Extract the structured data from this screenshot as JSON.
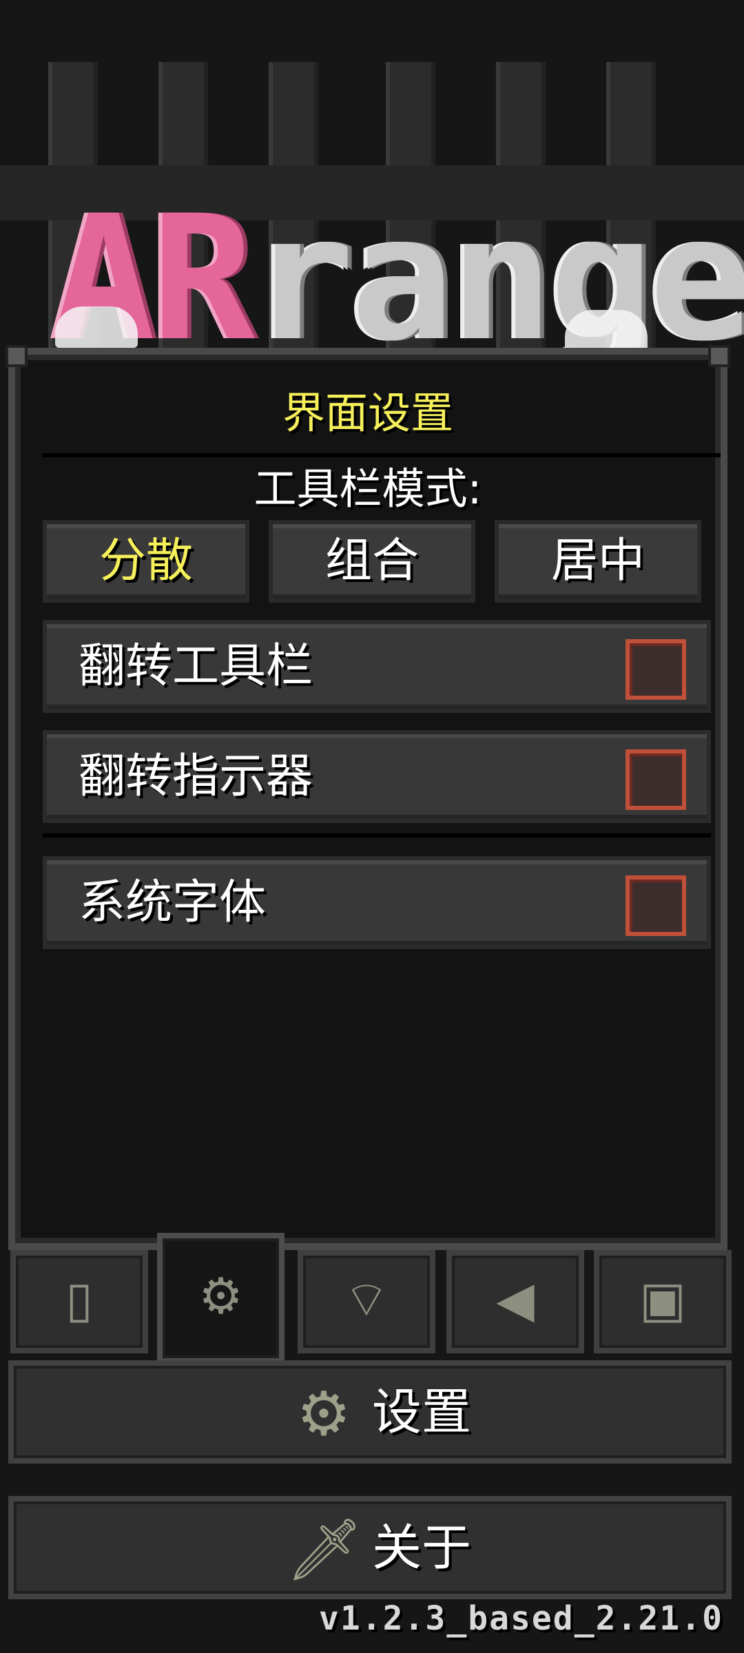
{
  "logo": {
    "part1": "AR",
    "part2": "ranged"
  },
  "window": {
    "title": "界面设置",
    "toolbar_mode_label": "工具栏模式:",
    "toolbar_modes": [
      {
        "label": "分散",
        "selected": true
      },
      {
        "label": "组合",
        "selected": false
      },
      {
        "label": "居中",
        "selected": false
      }
    ],
    "options": [
      {
        "label": "翻转工具栏",
        "checked": false
      },
      {
        "label": "翻转指示器",
        "checked": false
      },
      {
        "label": "系统字体",
        "checked": false
      }
    ]
  },
  "tabs": [
    {
      "icon": "phone-icon"
    },
    {
      "icon": "gears-icon",
      "active": true
    },
    {
      "icon": "wifi-icon"
    },
    {
      "icon": "speaker-icon"
    },
    {
      "icon": "language-icon"
    }
  ],
  "buttons": {
    "settings": "设置",
    "about": "关于"
  },
  "version": "v1.2.3_based_2.21.0",
  "colors": {
    "highlight": "#f6f05a",
    "checkbox_border": "#c0503a"
  }
}
